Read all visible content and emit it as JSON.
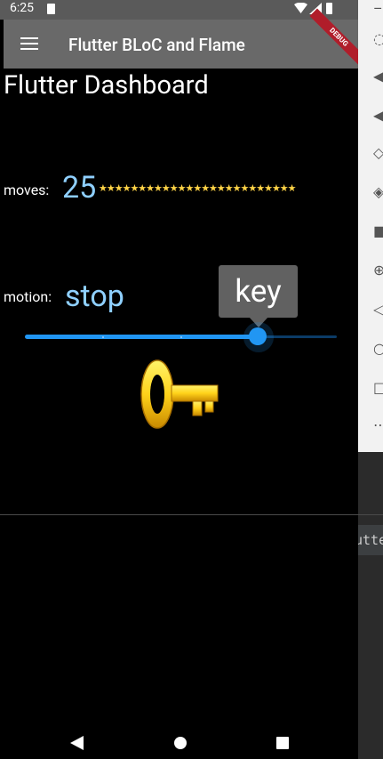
{
  "status_bar": {
    "time": "6:25"
  },
  "app_bar": {
    "title": "Flutter BLoC and Flame",
    "debug_banner": "DEBUG"
  },
  "dashboard": {
    "title": "Flutter Dashboard",
    "moves": {
      "label": "moves:",
      "value": "25",
      "stars": "★★★★★★★★★★★★★★★★★★★★★★★★★"
    },
    "motion": {
      "label": "motion:",
      "value": "stop"
    },
    "slider": {
      "tooltip": "key",
      "value_fraction": 0.75,
      "divisions": 4
    }
  },
  "ide_panel": {
    "tab_text": "utte"
  }
}
